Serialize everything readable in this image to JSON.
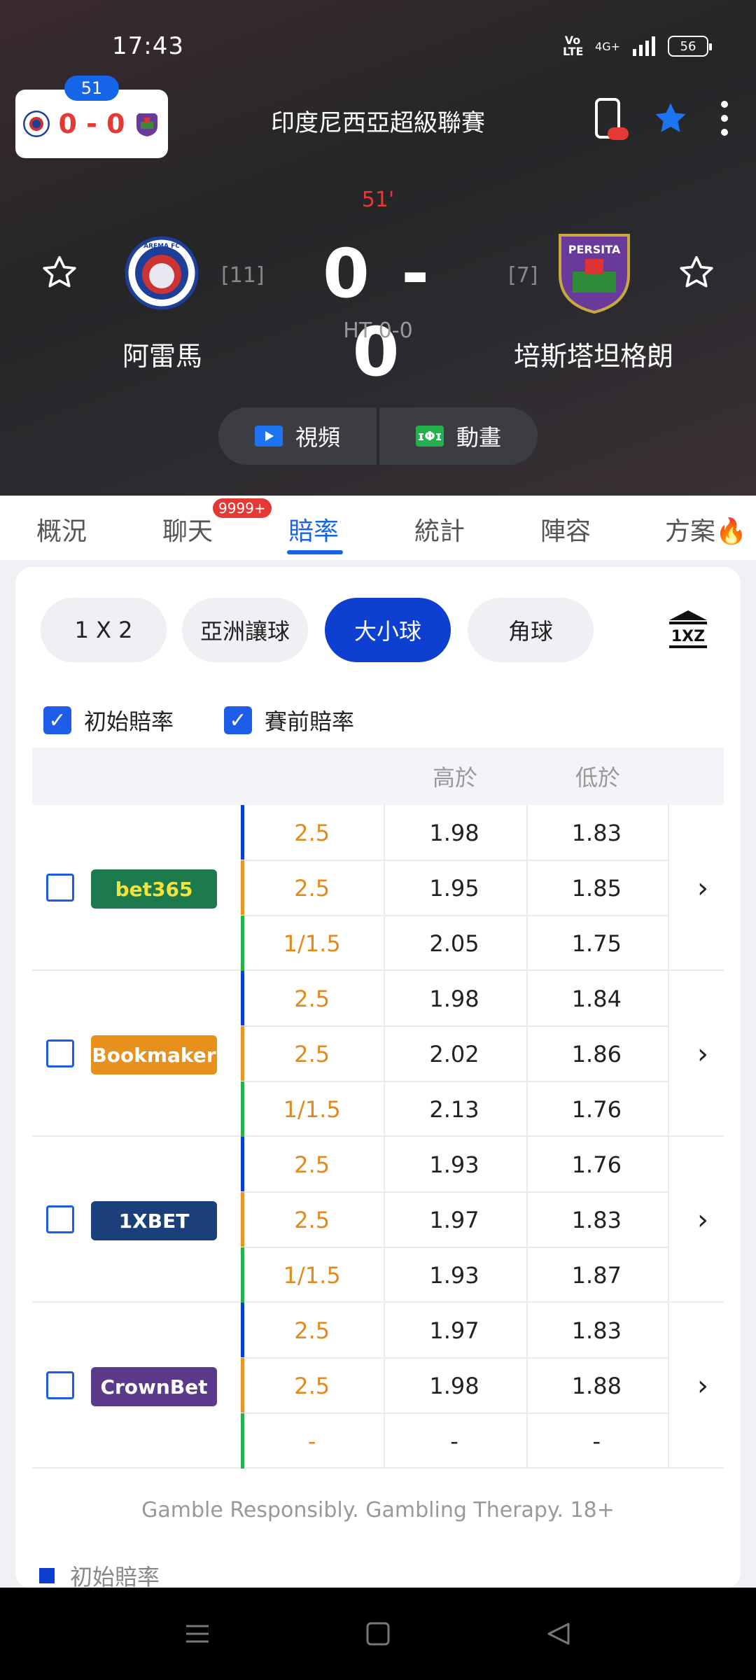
{
  "status": {
    "time": "17:43",
    "network": "4G+",
    "volte": "Vo LTE",
    "battery": "56"
  },
  "mini": {
    "minute": "51",
    "score": "0 - 0"
  },
  "league": "印度尼西亞超級聯賽",
  "match": {
    "minute": "51'",
    "score": "0 - 0",
    "ht": "HT 0-0",
    "home": {
      "name": "阿雷馬",
      "rank": "[11]",
      "logo_text": "AREMA FC"
    },
    "away": {
      "name": "培斯塔坦格朗",
      "rank": "[7]",
      "logo_text": "PERSITA"
    }
  },
  "media": {
    "video": "視頻",
    "animation": "動畫",
    "anim_icon": "ɪΦɪ"
  },
  "tabs": [
    {
      "label": "概況"
    },
    {
      "label": "聊天",
      "badge": "9999+"
    },
    {
      "label": "賠率",
      "active": true
    },
    {
      "label": "統計"
    },
    {
      "label": "陣容"
    },
    {
      "label": "方案"
    }
  ],
  "segments": [
    "1 X 2",
    "亞洲讓球",
    "大小球",
    "角球"
  ],
  "active_segment": "大小球",
  "checks": {
    "initial": "初始賠率",
    "pre": "賽前賠率"
  },
  "table": {
    "over": "高於",
    "under": "低於"
  },
  "books": [
    {
      "name": "bet365",
      "rows": [
        [
          "2.5",
          "1.98",
          "1.83"
        ],
        [
          "2.5",
          "1.95",
          "1.85"
        ],
        [
          "1/1.5",
          "2.05",
          "1.75"
        ]
      ]
    },
    {
      "name": "Bookmaker",
      "rows": [
        [
          "2.5",
          "1.98",
          "1.84"
        ],
        [
          "2.5",
          "2.02",
          "1.86"
        ],
        [
          "1/1.5",
          "2.13",
          "1.76"
        ]
      ]
    },
    {
      "name": "1XBET",
      "rows": [
        [
          "2.5",
          "1.93",
          "1.76"
        ],
        [
          "2.5",
          "1.97",
          "1.83"
        ],
        [
          "1/1.5",
          "1.93",
          "1.87"
        ]
      ]
    },
    {
      "name": "CrownBet",
      "rows": [
        [
          "2.5",
          "1.97",
          "1.83"
        ],
        [
          "2.5",
          "1.98",
          "1.88"
        ],
        [
          "-",
          "-",
          "-"
        ]
      ]
    }
  ],
  "row_colors": [
    "#0d3fd0",
    "#e8962a",
    "#2ab04a"
  ],
  "book_colors": [
    "#1d7a4d",
    "#e8901c",
    "#1a3f7a",
    "#5b3a8c"
  ],
  "gamble": "Gamble Responsibly. Gambling Therapy. 18+",
  "legend": "初始賠率"
}
